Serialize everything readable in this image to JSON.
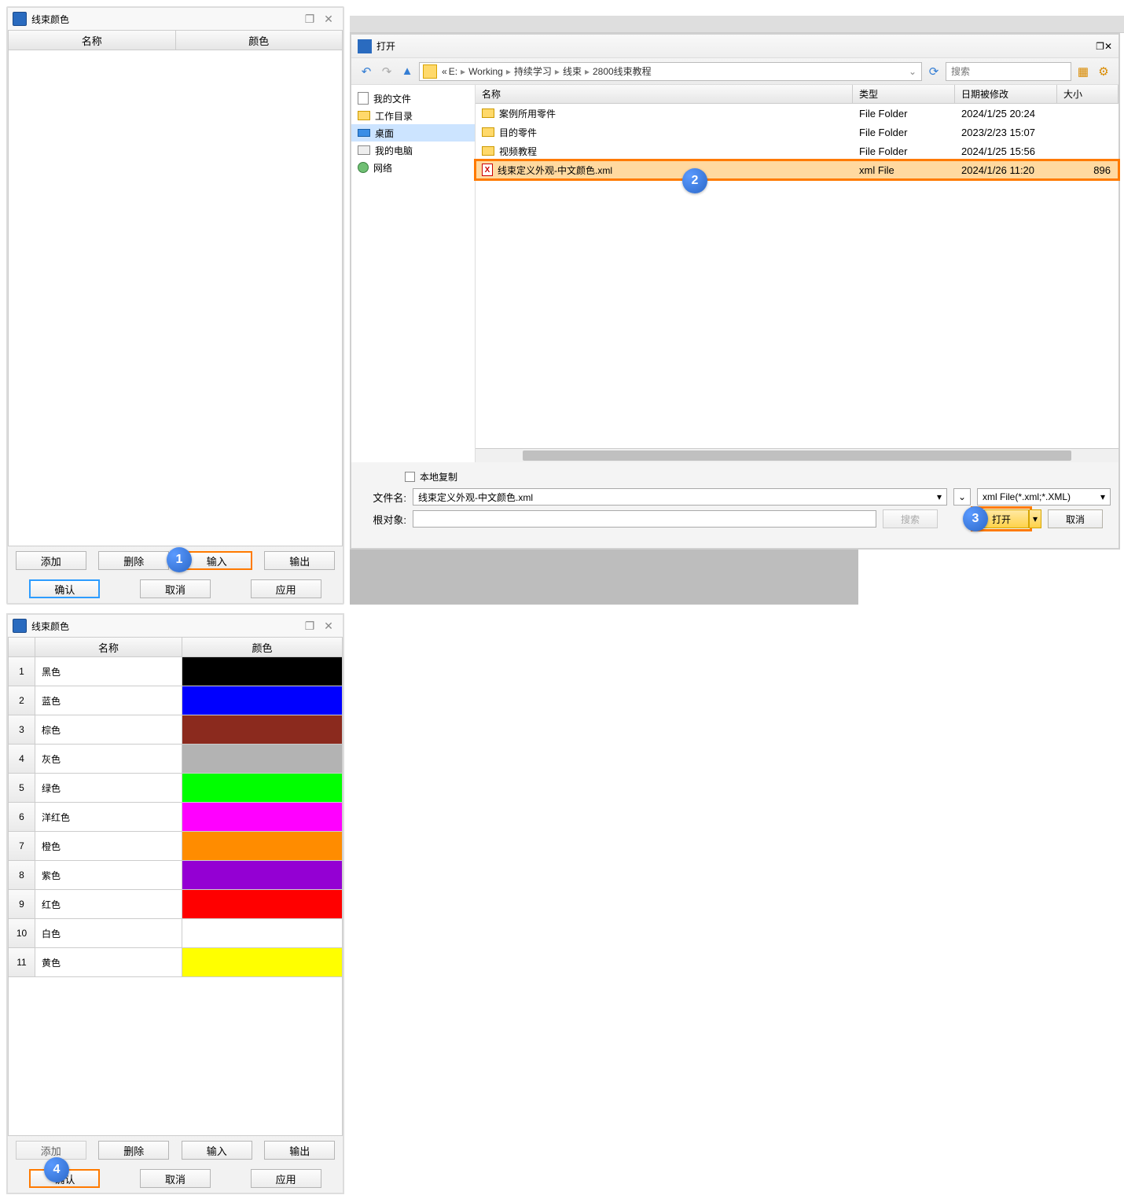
{
  "panel_title": "线束颜色",
  "columns": {
    "name": "名称",
    "color": "颜色"
  },
  "buttons": {
    "add": "添加",
    "delete": "删除",
    "import": "输入",
    "export": "输出",
    "ok": "确认",
    "cancel": "取消",
    "apply": "应用"
  },
  "open_dialog": {
    "title": "打开",
    "breadcrumb": [
      "E:",
      "Working",
      "持续学习",
      "线束",
      "2800线束教程"
    ],
    "search_placeholder": "搜索",
    "tree": [
      {
        "label": "我的文件",
        "icon": "doc"
      },
      {
        "label": "工作目录",
        "icon": "folder"
      },
      {
        "label": "桌面",
        "icon": "desktop",
        "selected": true
      },
      {
        "label": "我的电脑",
        "icon": "pc"
      },
      {
        "label": "网络",
        "icon": "net"
      }
    ],
    "columns": {
      "name": "名称",
      "type": "类型",
      "date": "日期被修改",
      "size": "大小"
    },
    "rows": [
      {
        "name": "案例所用零件",
        "type": "File Folder",
        "date": "2024/1/25 20:24",
        "size": "",
        "icon": "folder"
      },
      {
        "name": "目的零件",
        "type": "File Folder",
        "date": "2023/2/23 15:07",
        "size": "",
        "icon": "folder"
      },
      {
        "name": "视频教程",
        "type": "File Folder",
        "date": "2024/1/25 15:56",
        "size": "",
        "icon": "folder"
      },
      {
        "name": "线束定义外观-中文颜色.xml",
        "type": "xml File",
        "date": "2024/1/26 11:20",
        "size": "896",
        "icon": "xml",
        "selected": true
      }
    ],
    "local_copy": "本地复制",
    "filename_label": "文件名:",
    "filename_value": "线束定义外观-中文颜色.xml",
    "root_label": "根对象:",
    "root_value": "",
    "search_btn": "搜索",
    "filter": "xml File(*.xml;*.XML)",
    "open_btn": "打开",
    "cancel_btn": "取消"
  },
  "color_rows": [
    {
      "n": "1",
      "name": "黑色",
      "hex": "#000000"
    },
    {
      "n": "2",
      "name": "蓝色",
      "hex": "#0000ff"
    },
    {
      "n": "3",
      "name": "棕色",
      "hex": "#8b2a1e"
    },
    {
      "n": "4",
      "name": "灰色",
      "hex": "#b3b3b3"
    },
    {
      "n": "5",
      "name": "绿色",
      "hex": "#00ff00"
    },
    {
      "n": "6",
      "name": "洋红色",
      "hex": "#ff00ff"
    },
    {
      "n": "7",
      "name": "橙色",
      "hex": "#ff8c00"
    },
    {
      "n": "8",
      "name": "紫色",
      "hex": "#9400d3"
    },
    {
      "n": "9",
      "name": "红色",
      "hex": "#ff0000"
    },
    {
      "n": "10",
      "name": "白色",
      "hex": "#ffffff"
    },
    {
      "n": "11",
      "name": "黄色",
      "hex": "#ffff00"
    }
  ],
  "badges": {
    "b1": "1",
    "b2": "2",
    "b3": "3",
    "b4": "4"
  }
}
